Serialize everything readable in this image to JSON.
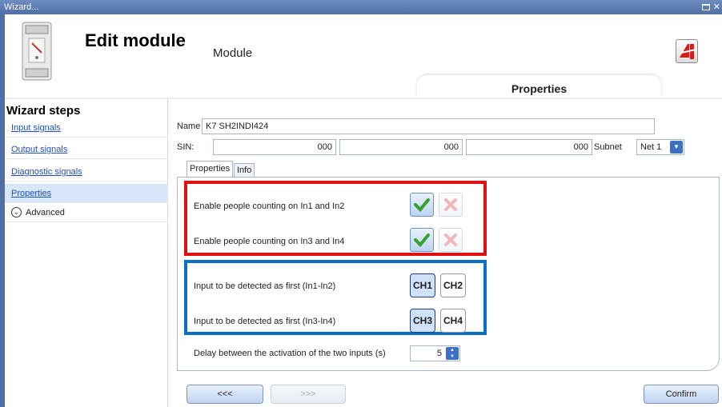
{
  "window": {
    "title": "Wizard..."
  },
  "header": {
    "title": "Edit module",
    "subtitle": "Module",
    "active_tab": "Properties"
  },
  "sidebar": {
    "title": "Wizard steps",
    "items": [
      {
        "label": "Input signals"
      },
      {
        "label": "Output signals"
      },
      {
        "label": "Diagnostic signals"
      },
      {
        "label": "Properties"
      }
    ],
    "advanced_label": "Advanced"
  },
  "form": {
    "name_label": "Name",
    "name_value": "K7 SH2INDI424",
    "sin_label": "SIN:",
    "sin_values": [
      "000",
      "000",
      "000"
    ],
    "subnet_label": "Subnet",
    "subnet_value": "Net 1",
    "tabs": [
      "Properties",
      "Info"
    ]
  },
  "properties": {
    "counting_rows": [
      {
        "label": "Enable people counting on In1 and In2"
      },
      {
        "label": "Enable people counting on In3 and In4"
      }
    ],
    "detect_rows": [
      {
        "label": "Input to be detected as first (In1-In2)",
        "options": [
          "CH1",
          "CH2"
        ],
        "selected": "CH1"
      },
      {
        "label": "Input to be detected as first (In3-In4)",
        "options": [
          "CH3",
          "CH4"
        ],
        "selected": "CH3"
      }
    ],
    "delay_label": "Delay between the activation of the two inputs (s)",
    "delay_value": "5"
  },
  "footer": {
    "back_label": "<<<",
    "next_label": ">>>",
    "confirm_label": "Confirm"
  },
  "colors": {
    "highlight_red": "#e01010",
    "highlight_blue": "#0a6fc8",
    "title_bar": "#4f6fa6"
  }
}
